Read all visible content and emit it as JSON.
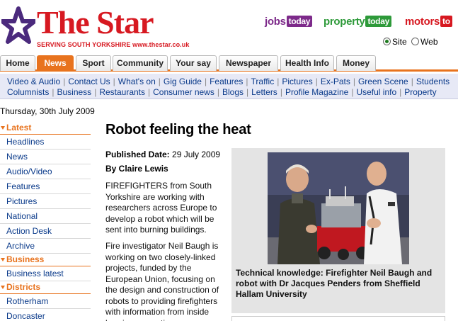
{
  "header": {
    "logo_text": "The Star",
    "logo_tagline": "SERVING SOUTH YORKSHIRE www.thestar.co.uk",
    "partners": [
      {
        "name": "jobs",
        "box": "today"
      },
      {
        "name": "property",
        "box": "today"
      },
      {
        "name": "motors",
        "box": "to"
      }
    ],
    "search_options": [
      {
        "label": "Site",
        "selected": true
      },
      {
        "label": "Web",
        "selected": false
      }
    ]
  },
  "tabs": [
    {
      "label": "Home",
      "active": false
    },
    {
      "label": "News",
      "active": true
    },
    {
      "label": "Sport",
      "active": false
    },
    {
      "label": "Community",
      "active": false
    },
    {
      "label": "Your say",
      "active": false
    },
    {
      "label": "Newspaper",
      "active": false
    },
    {
      "label": "Health Info",
      "active": false
    },
    {
      "label": "Money",
      "active": false
    }
  ],
  "subnav": {
    "row1": [
      "Video & Audio",
      "Contact Us",
      "What's on",
      "Gig Guide",
      "Features",
      "Traffic",
      "Pictures",
      "Ex-Pats",
      "Green Scene",
      "Students"
    ],
    "row2": [
      "Columnists",
      "Business",
      "Restaurants",
      "Consumer news",
      "Blogs",
      "Letters",
      "Profile Magazine",
      "Useful info",
      "Property"
    ]
  },
  "date": "Thursday, 30th July 2009",
  "leftnav": [
    {
      "heading": "Latest",
      "items": [
        "Headlines",
        "News",
        "Audio/Video",
        "Features",
        "Pictures",
        "National",
        "Action Desk",
        "Archive"
      ]
    },
    {
      "heading": "Business",
      "items": [
        "Business latest"
      ]
    },
    {
      "heading": "Districts",
      "items": [
        "Rotherham",
        "Doncaster"
      ]
    }
  ],
  "article": {
    "title": "Robot feeling the heat",
    "published_label": "Published Date:",
    "published_date": "29 July 2009",
    "author": "By Claire Lewis",
    "paragraphs": [
      "FIREFIGHTERS from South Yorkshire are working with researchers across Europe to develop a robot which will be sent into burning buildings.",
      "Fire investigator Neil Baugh is working on two closely-linked projects, funded by the European Union, focusing on the design and construction of robots to providing firefighters with information from inside burning properties."
    ],
    "photo_caption": "Technical knowledge: Firefighter Neil Baugh and robot with Dr Jacques Penders from Sheffield Hallam University"
  },
  "colors": {
    "brand_red": "#d71921",
    "accent_orange": "#e8731e",
    "link_blue": "#0a3a8a",
    "subnav_bg": "#e7e9f6"
  }
}
